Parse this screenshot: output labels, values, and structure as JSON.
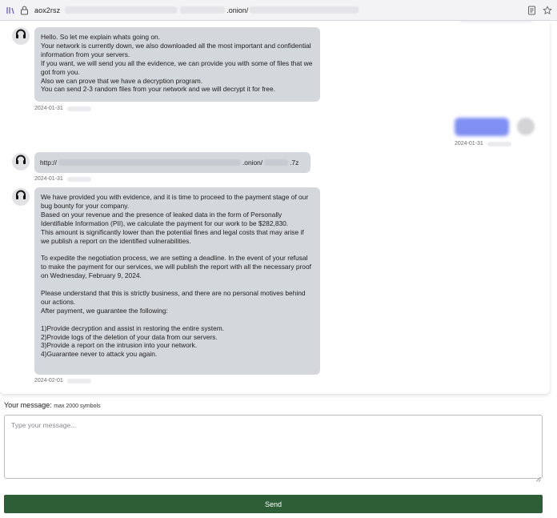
{
  "browser": {
    "url_prefix": "aox2rsz",
    "url_suffix": ".onion/",
    "icons": [
      "tab-manager-icon",
      "lock-icon",
      "reader-view-icon",
      "bookmark-star-icon"
    ]
  },
  "messages": [
    {
      "sender": "support",
      "text": "Hello. So let me explain whats going on.\nYour network is currently down, we also downloaded all the most important and confidential information from your servers.\nIf you want, we will send you all the evidence, we can provide you with some of files that we got from you.\nAlso we can prove that we have a decryption program.\nYou can send 2-3 random files from your network and we will decrypt it for free.",
      "date": "2024-01-31"
    },
    {
      "sender": "user",
      "text": "",
      "date": "2024-01-31"
    },
    {
      "sender": "support",
      "link_prefix": "http://",
      "link_mid": ".onion/",
      "link_end": ".7z",
      "date": "2024-01-31"
    },
    {
      "sender": "support",
      "text": "We have provided you with evidence, and it is time to proceed to the payment stage of our bug bounty for your company.\nBased on your revenue and the presence of leaked data in the form of Personally Identifiable Information (PII), we calculate the payment for our work to be $282,830.\nThis amount is significantly lower than the potential fines and legal costs that may arise if we publish a report on the identified vulnerabilities.\n\nTo expedite the negotiation process, we are setting a deadline. In the event of your refusal to make the payment for our services, we will publish the report with all the necessary proof on Wednesday, February 9, 2024.\n\nPlease understand that this is strictly business, and there are no personal motives behind our actions.\nAfter payment, we guarantee the following:\n\n1)Provide decryption and assist in restoring the entire system.\n2)Provide logs of the deletion of your data from our servers.\n3)Provide a report on the intrusion into your network.\n4)Guarantee never to attack you again.",
      "date": "2024-02-01"
    }
  ],
  "composer": {
    "label": "Your message:",
    "hint": "max 2000 symbols",
    "placeholder": "Type your message...",
    "send_label": "Send"
  },
  "colors": {
    "support_bubble": "#d4d7dc",
    "user_bubble": "#7f8ff2",
    "send_button": "#2d5e36"
  }
}
